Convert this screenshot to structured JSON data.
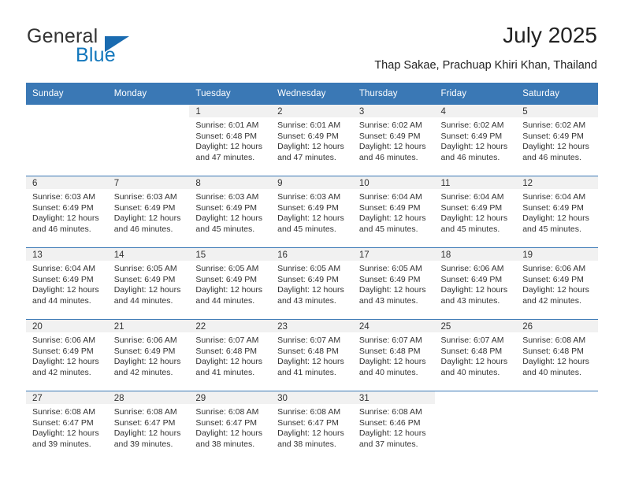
{
  "brand": {
    "name_part1": "General",
    "name_part2": "Blue",
    "accent_color": "#1277bc",
    "triangle_color": "#1a6bb0"
  },
  "header": {
    "title": "July 2025",
    "subtitle": "Thap Sakae, Prachuap Khiri Khan, Thailand",
    "header_bg": "#3a78b5"
  },
  "calendar": {
    "weekday_headers": [
      "Sunday",
      "Monday",
      "Tuesday",
      "Wednesday",
      "Thursday",
      "Friday",
      "Saturday"
    ],
    "weeks": [
      [
        {
          "day": "",
          "blank": true
        },
        {
          "day": "",
          "blank": true
        },
        {
          "day": "1",
          "sunrise": "Sunrise: 6:01 AM",
          "sunset": "Sunset: 6:48 PM",
          "daylight": "Daylight: 12 hours and 47 minutes."
        },
        {
          "day": "2",
          "sunrise": "Sunrise: 6:01 AM",
          "sunset": "Sunset: 6:49 PM",
          "daylight": "Daylight: 12 hours and 47 minutes."
        },
        {
          "day": "3",
          "sunrise": "Sunrise: 6:02 AM",
          "sunset": "Sunset: 6:49 PM",
          "daylight": "Daylight: 12 hours and 46 minutes."
        },
        {
          "day": "4",
          "sunrise": "Sunrise: 6:02 AM",
          "sunset": "Sunset: 6:49 PM",
          "daylight": "Daylight: 12 hours and 46 minutes."
        },
        {
          "day": "5",
          "sunrise": "Sunrise: 6:02 AM",
          "sunset": "Sunset: 6:49 PM",
          "daylight": "Daylight: 12 hours and 46 minutes."
        }
      ],
      [
        {
          "day": "6",
          "sunrise": "Sunrise: 6:03 AM",
          "sunset": "Sunset: 6:49 PM",
          "daylight": "Daylight: 12 hours and 46 minutes."
        },
        {
          "day": "7",
          "sunrise": "Sunrise: 6:03 AM",
          "sunset": "Sunset: 6:49 PM",
          "daylight": "Daylight: 12 hours and 46 minutes."
        },
        {
          "day": "8",
          "sunrise": "Sunrise: 6:03 AM",
          "sunset": "Sunset: 6:49 PM",
          "daylight": "Daylight: 12 hours and 45 minutes."
        },
        {
          "day": "9",
          "sunrise": "Sunrise: 6:03 AM",
          "sunset": "Sunset: 6:49 PM",
          "daylight": "Daylight: 12 hours and 45 minutes."
        },
        {
          "day": "10",
          "sunrise": "Sunrise: 6:04 AM",
          "sunset": "Sunset: 6:49 PM",
          "daylight": "Daylight: 12 hours and 45 minutes."
        },
        {
          "day": "11",
          "sunrise": "Sunrise: 6:04 AM",
          "sunset": "Sunset: 6:49 PM",
          "daylight": "Daylight: 12 hours and 45 minutes."
        },
        {
          "day": "12",
          "sunrise": "Sunrise: 6:04 AM",
          "sunset": "Sunset: 6:49 PM",
          "daylight": "Daylight: 12 hours and 45 minutes."
        }
      ],
      [
        {
          "day": "13",
          "sunrise": "Sunrise: 6:04 AM",
          "sunset": "Sunset: 6:49 PM",
          "daylight": "Daylight: 12 hours and 44 minutes."
        },
        {
          "day": "14",
          "sunrise": "Sunrise: 6:05 AM",
          "sunset": "Sunset: 6:49 PM",
          "daylight": "Daylight: 12 hours and 44 minutes."
        },
        {
          "day": "15",
          "sunrise": "Sunrise: 6:05 AM",
          "sunset": "Sunset: 6:49 PM",
          "daylight": "Daylight: 12 hours and 44 minutes."
        },
        {
          "day": "16",
          "sunrise": "Sunrise: 6:05 AM",
          "sunset": "Sunset: 6:49 PM",
          "daylight": "Daylight: 12 hours and 43 minutes."
        },
        {
          "day": "17",
          "sunrise": "Sunrise: 6:05 AM",
          "sunset": "Sunset: 6:49 PM",
          "daylight": "Daylight: 12 hours and 43 minutes."
        },
        {
          "day": "18",
          "sunrise": "Sunrise: 6:06 AM",
          "sunset": "Sunset: 6:49 PM",
          "daylight": "Daylight: 12 hours and 43 minutes."
        },
        {
          "day": "19",
          "sunrise": "Sunrise: 6:06 AM",
          "sunset": "Sunset: 6:49 PM",
          "daylight": "Daylight: 12 hours and 42 minutes."
        }
      ],
      [
        {
          "day": "20",
          "sunrise": "Sunrise: 6:06 AM",
          "sunset": "Sunset: 6:49 PM",
          "daylight": "Daylight: 12 hours and 42 minutes."
        },
        {
          "day": "21",
          "sunrise": "Sunrise: 6:06 AM",
          "sunset": "Sunset: 6:49 PM",
          "daylight": "Daylight: 12 hours and 42 minutes."
        },
        {
          "day": "22",
          "sunrise": "Sunrise: 6:07 AM",
          "sunset": "Sunset: 6:48 PM",
          "daylight": "Daylight: 12 hours and 41 minutes."
        },
        {
          "day": "23",
          "sunrise": "Sunrise: 6:07 AM",
          "sunset": "Sunset: 6:48 PM",
          "daylight": "Daylight: 12 hours and 41 minutes."
        },
        {
          "day": "24",
          "sunrise": "Sunrise: 6:07 AM",
          "sunset": "Sunset: 6:48 PM",
          "daylight": "Daylight: 12 hours and 40 minutes."
        },
        {
          "day": "25",
          "sunrise": "Sunrise: 6:07 AM",
          "sunset": "Sunset: 6:48 PM",
          "daylight": "Daylight: 12 hours and 40 minutes."
        },
        {
          "day": "26",
          "sunrise": "Sunrise: 6:08 AM",
          "sunset": "Sunset: 6:48 PM",
          "daylight": "Daylight: 12 hours and 40 minutes."
        }
      ],
      [
        {
          "day": "27",
          "sunrise": "Sunrise: 6:08 AM",
          "sunset": "Sunset: 6:47 PM",
          "daylight": "Daylight: 12 hours and 39 minutes."
        },
        {
          "day": "28",
          "sunrise": "Sunrise: 6:08 AM",
          "sunset": "Sunset: 6:47 PM",
          "daylight": "Daylight: 12 hours and 39 minutes."
        },
        {
          "day": "29",
          "sunrise": "Sunrise: 6:08 AM",
          "sunset": "Sunset: 6:47 PM",
          "daylight": "Daylight: 12 hours and 38 minutes."
        },
        {
          "day": "30",
          "sunrise": "Sunrise: 6:08 AM",
          "sunset": "Sunset: 6:47 PM",
          "daylight": "Daylight: 12 hours and 38 minutes."
        },
        {
          "day": "31",
          "sunrise": "Sunrise: 6:08 AM",
          "sunset": "Sunset: 6:46 PM",
          "daylight": "Daylight: 12 hours and 37 minutes."
        },
        {
          "day": "",
          "blank": true
        },
        {
          "day": "",
          "blank": true
        }
      ]
    ]
  }
}
